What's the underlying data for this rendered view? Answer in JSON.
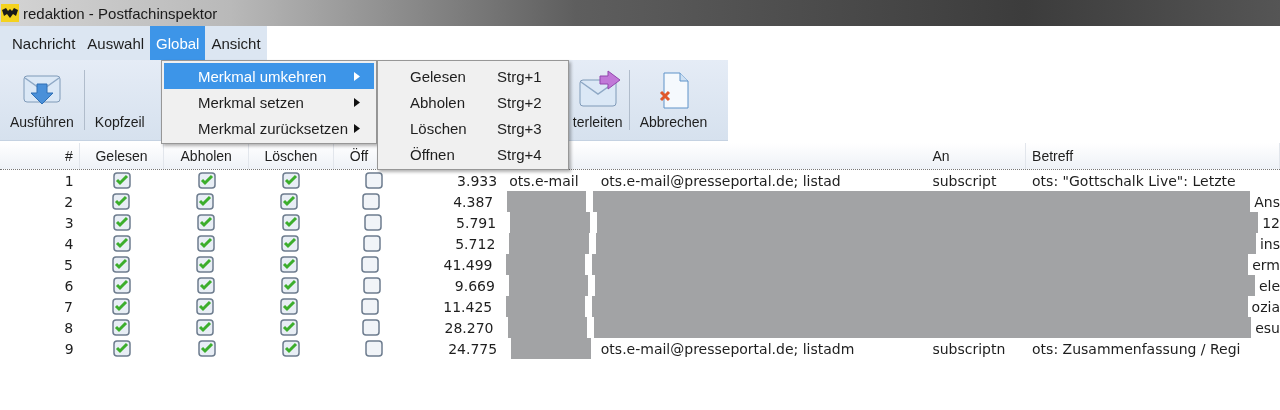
{
  "window": {
    "title": "redaktion - Postfachinspektor"
  },
  "menubar": [
    {
      "label": "Nachricht",
      "selected": false
    },
    {
      "label": "Auswahl",
      "selected": false
    },
    {
      "label": "Global",
      "selected": true
    },
    {
      "label": "Ansicht",
      "selected": false
    }
  ],
  "toolbar": [
    {
      "label": "Ausführen",
      "kind": "download"
    },
    {
      "label": "Kopfzeil",
      "kind": "hidden"
    },
    {
      "label": "terleiten",
      "kind": "forward"
    },
    {
      "label": "Abbrechen",
      "kind": "cancel"
    }
  ],
  "menu": {
    "items": [
      {
        "label": "Merkmal umkehren",
        "selected": true
      },
      {
        "label": "Merkmal setzen",
        "selected": false
      },
      {
        "label": "Merkmal zurücksetzen",
        "selected": false
      }
    ],
    "submenu": [
      {
        "label": "Gelesen",
        "shortcut": "Strg+1"
      },
      {
        "label": "Abholen",
        "shortcut": "Strg+2"
      },
      {
        "label": "Löschen",
        "shortcut": "Strg+3"
      },
      {
        "label": "Öffnen",
        "shortcut": "Strg+4"
      }
    ]
  },
  "table": {
    "columns": [
      "#",
      "Gelesen",
      "Abholen",
      "Löschen",
      "Öff",
      "An",
      "Betreff"
    ],
    "rows": [
      {
        "number": "1",
        "gelesen": true,
        "abholen": true,
        "loeschen": true,
        "oeffnen": false,
        "size": "3.933",
        "kind": "plain",
        "column_6": "ots.e-mail",
        "column_7": "ots.e-mail@presseportal.de; listad",
        "an": "subscript",
        "betreff": "ots: \"Gottschalk Live\": Letzte"
      },
      {
        "number": "2",
        "gelesen": true,
        "abholen": true,
        "loeschen": true,
        "oeffnen": false,
        "size": "4.387",
        "kind": "redacted",
        "betreff": "Ans"
      },
      {
        "number": "3",
        "gelesen": true,
        "abholen": true,
        "loeschen": true,
        "oeffnen": false,
        "size": "5.791",
        "kind": "redacted",
        "betreff": "12"
      },
      {
        "number": "4",
        "gelesen": true,
        "abholen": true,
        "loeschen": true,
        "oeffnen": false,
        "size": "5.712",
        "kind": "redacted",
        "betreff": "ins"
      },
      {
        "number": "5",
        "gelesen": true,
        "abholen": true,
        "loeschen": true,
        "oeffnen": false,
        "size": "41.499",
        "kind": "redacted",
        "betreff": "erm"
      },
      {
        "number": "6",
        "gelesen": true,
        "abholen": true,
        "loeschen": true,
        "oeffnen": false,
        "size": "9.669",
        "kind": "redacted",
        "betreff": "ele"
      },
      {
        "number": "7",
        "gelesen": true,
        "abholen": true,
        "loeschen": true,
        "oeffnen": false,
        "size": "11.425",
        "kind": "redacted",
        "betreff": "ozia"
      },
      {
        "number": "8",
        "gelesen": true,
        "abholen": true,
        "loeschen": true,
        "oeffnen": false,
        "size": "28.270",
        "kind": "redacted",
        "betreff": "esu"
      },
      {
        "number": "9",
        "gelesen": true,
        "abholen": true,
        "loeschen": true,
        "oeffnen": false,
        "size": "24.775",
        "kind": "partly_redacted",
        "column_7": "ots.e-mail@presseportal.de; listadm",
        "an": "subscriptn",
        "betreff": "ots: Zusammenfassung / Regi"
      }
    ]
  }
}
